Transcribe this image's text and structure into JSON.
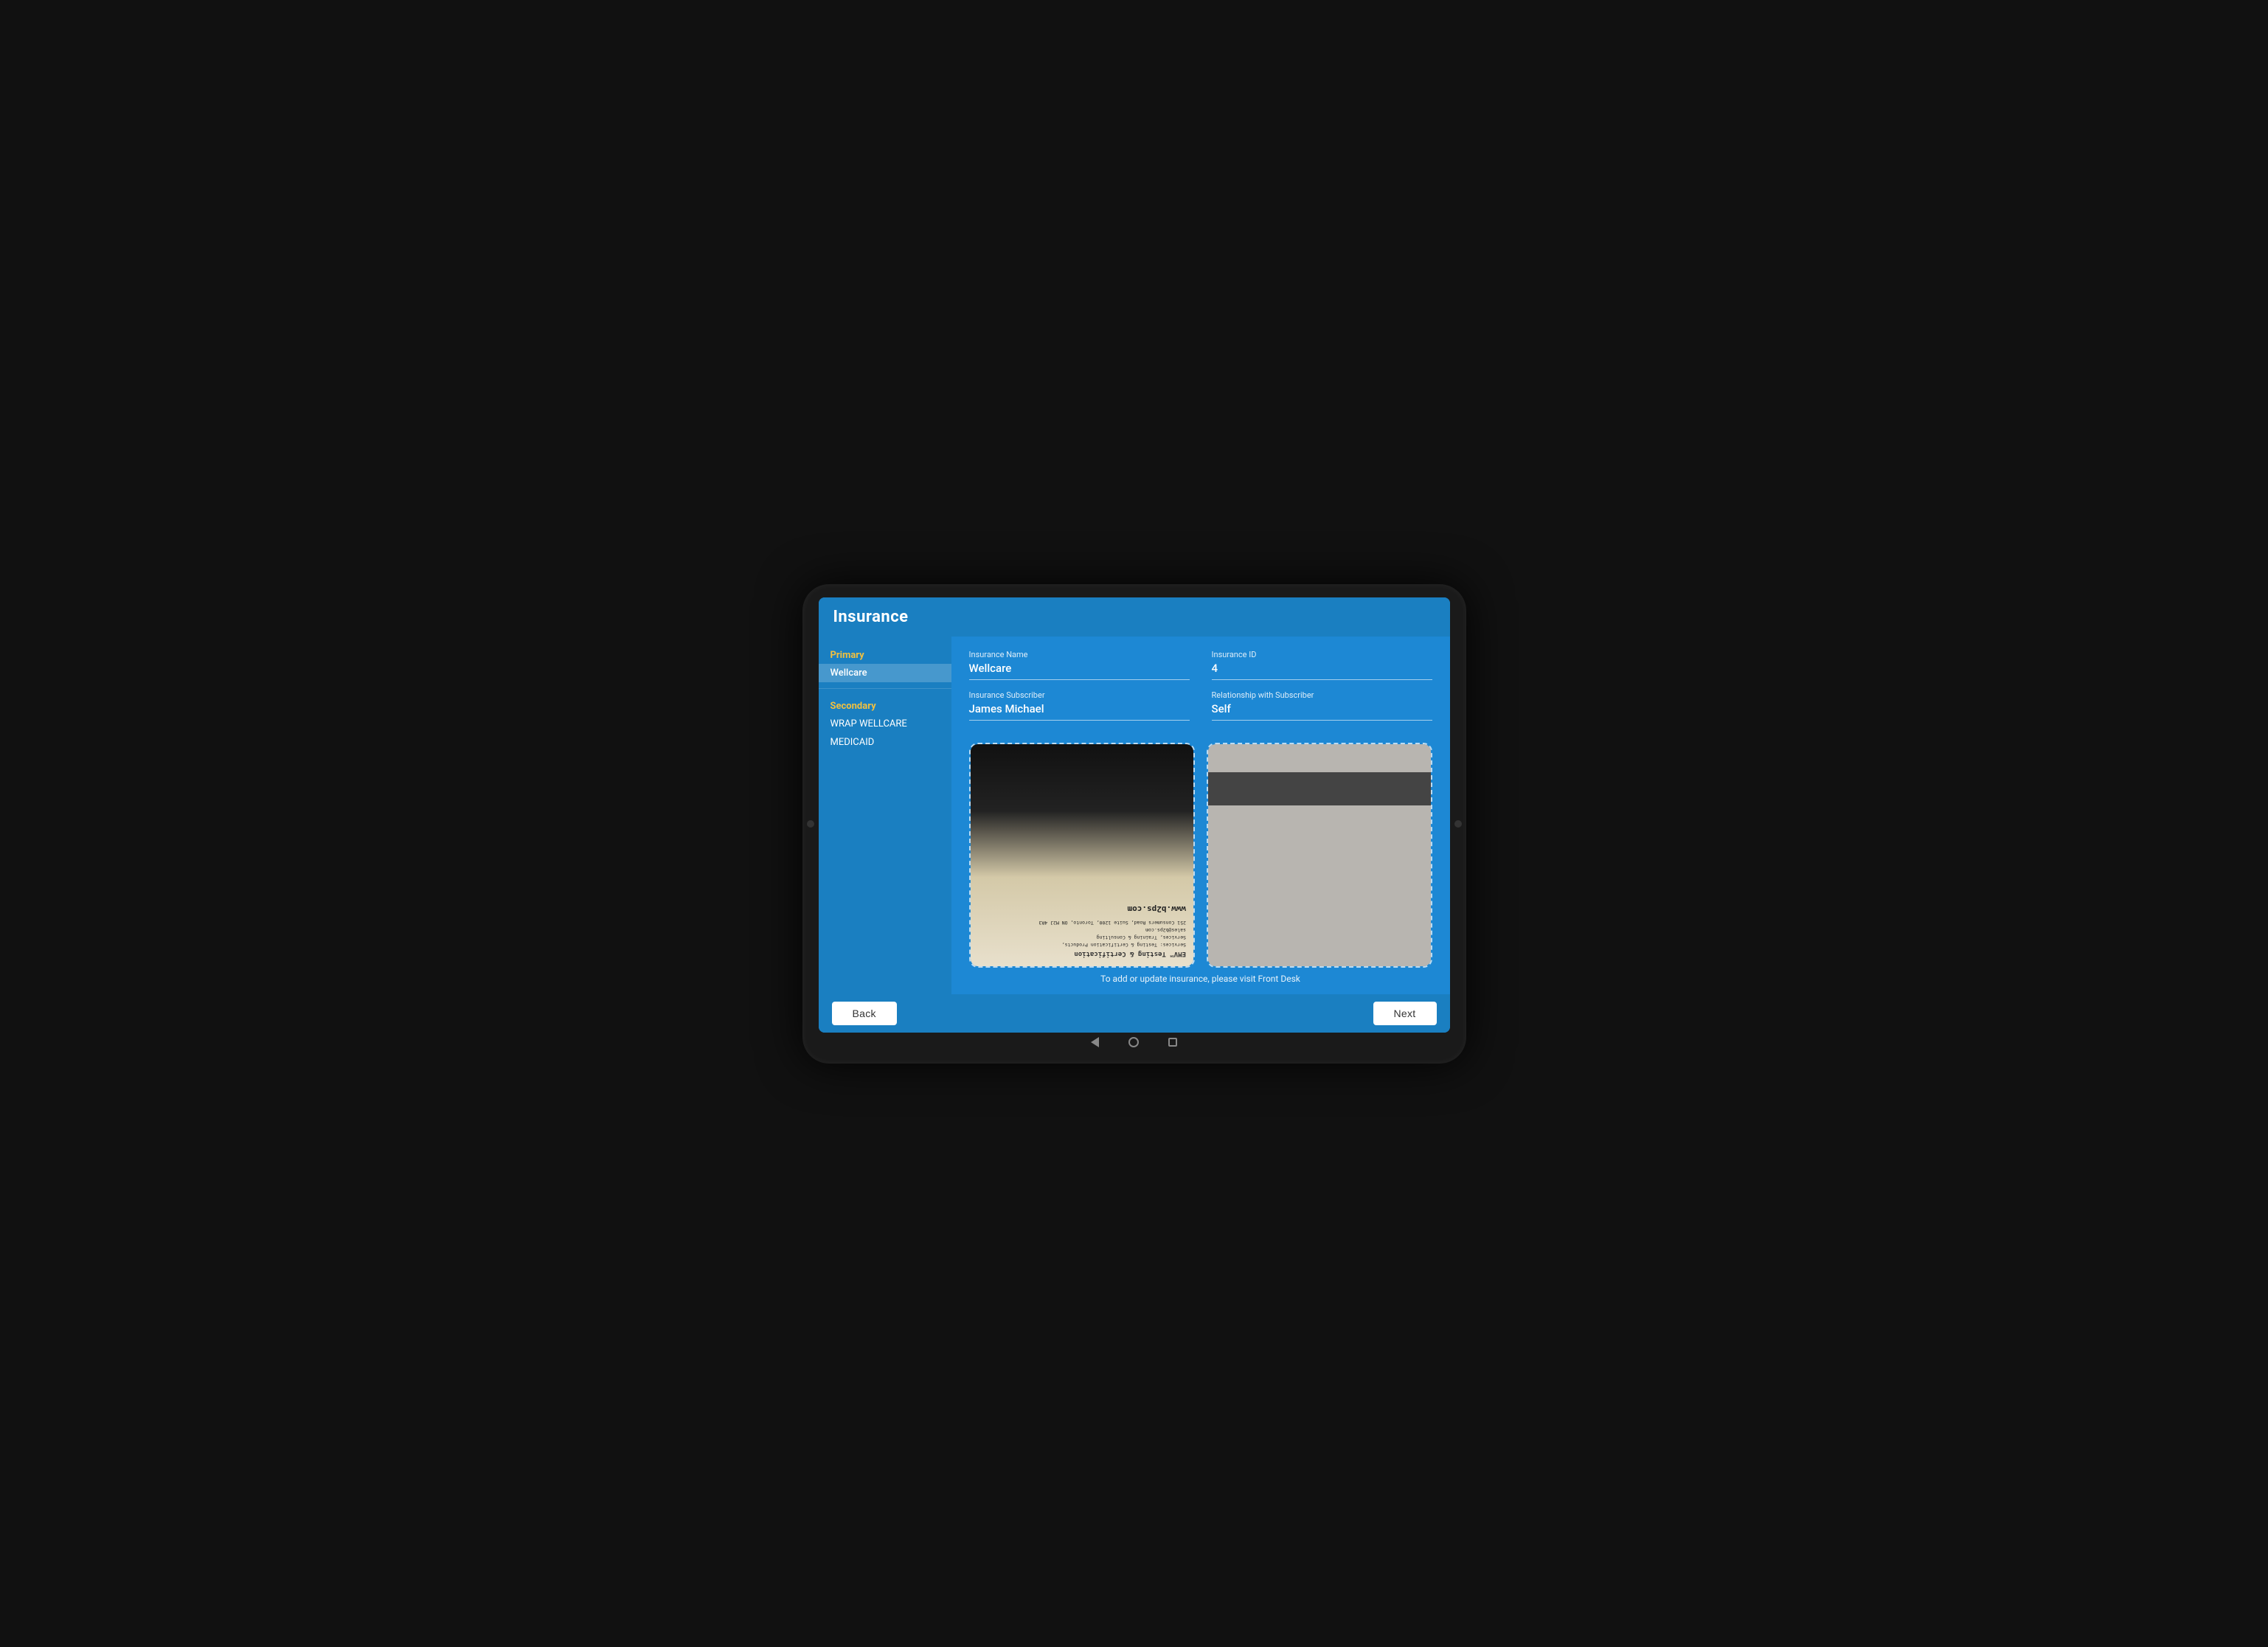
{
  "header": {
    "title": "Insurance"
  },
  "sidebar": {
    "primary_label": "Primary",
    "primary_items": [
      "Wellcare"
    ],
    "secondary_label": "Secondary",
    "secondary_items": [
      "WRAP WELLCARE",
      "MEDICAID"
    ]
  },
  "form": {
    "insurance_name_label": "Insurance Name",
    "insurance_name_value": "Wellcare",
    "insurance_id_label": "Insurance ID",
    "insurance_id_value": "4",
    "subscriber_label": "Insurance Subscriber",
    "subscriber_value": "James Michael",
    "relationship_label": "Relationship with Subscriber",
    "relationship_value": "Self"
  },
  "card_front": {
    "line1": "251 Consumers Road, Suite 1200, Toronto, ON M2J 4R3",
    "line2": "sales@b2ps.com",
    "line3": "Services: Testing & Certification Products,",
    "line4": "Services, Training & Consulting",
    "logo": "EMV™ Testing & Certification",
    "website": "www.b2ps.com"
  },
  "footer_notice": "To add or update insurance, please visit Front Desk",
  "buttons": {
    "back": "Back",
    "next": "Next"
  }
}
